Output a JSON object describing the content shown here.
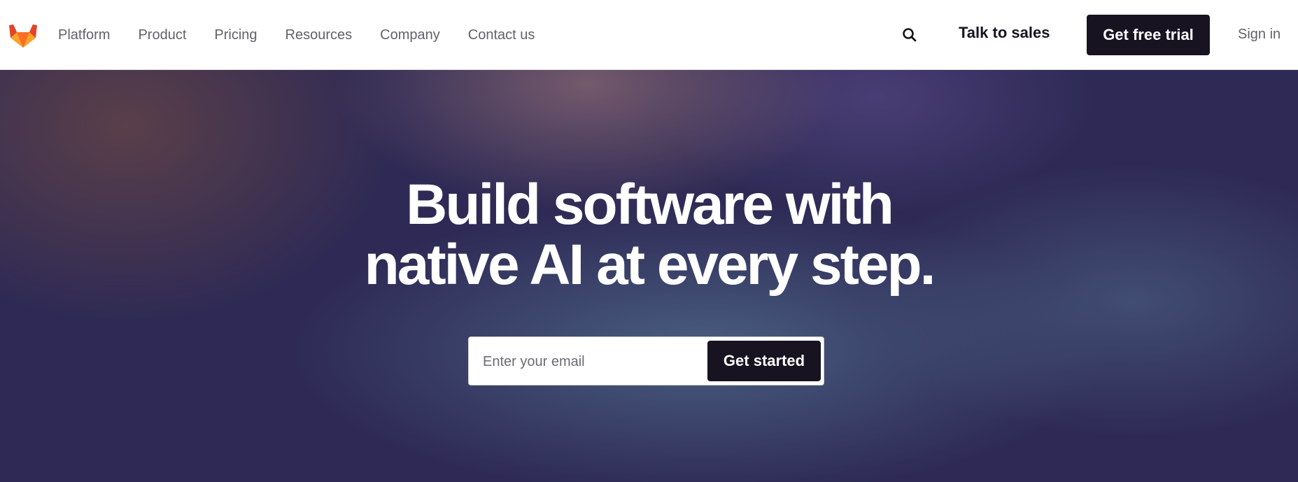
{
  "colors": {
    "brand_dark": "#171321",
    "nav_text": "#626168",
    "logo_orange": "#fc6d26",
    "logo_red": "#e24329",
    "logo_amber": "#fca326"
  },
  "header": {
    "logo_icon": "gitlab-tanuki-logo",
    "nav": [
      "Platform",
      "Product",
      "Pricing",
      "Resources",
      "Company",
      "Contact us"
    ],
    "search_icon": "search-icon",
    "talk_to_sales": "Talk to sales",
    "free_trial": "Get free trial",
    "sign_in": "Sign in"
  },
  "hero": {
    "headline_line1": "Build software with",
    "headline_line2": "native AI at every step.",
    "email_placeholder": "Enter your email",
    "email_value": "",
    "cta": "Get started"
  }
}
